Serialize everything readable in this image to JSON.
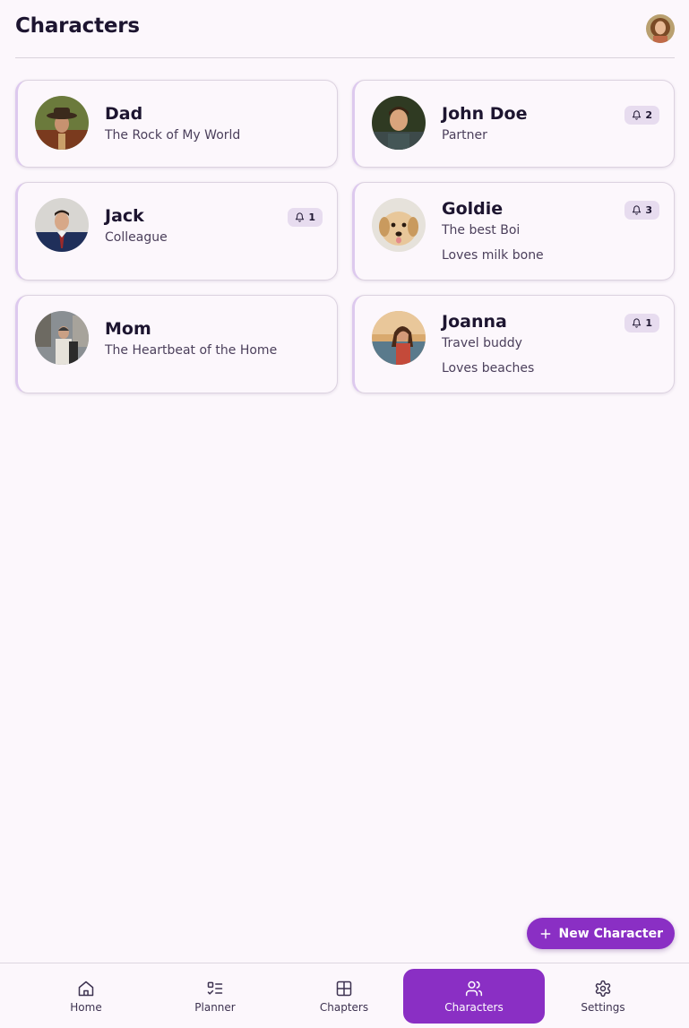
{
  "header": {
    "title": "Characters"
  },
  "characters": [
    {
      "name": "Dad",
      "role": "The Rock of My World",
      "extra": "",
      "notifications": ""
    },
    {
      "name": "John Doe",
      "role": "Partner",
      "extra": "",
      "notifications": "2"
    },
    {
      "name": "Jack",
      "role": "Colleague",
      "extra": "",
      "notifications": "1"
    },
    {
      "name": "Goldie",
      "role": "The best Boi",
      "extra": "Loves milk bone",
      "notifications": "3"
    },
    {
      "name": "Mom",
      "role": "The Heartbeat of the Home",
      "extra": "",
      "notifications": ""
    },
    {
      "name": "Joanna",
      "role": "Travel buddy",
      "extra": "Loves beaches",
      "notifications": "1"
    }
  ],
  "fab": {
    "label": "New Character"
  },
  "nav": {
    "home": "Home",
    "planner": "Planner",
    "chapters": "Chapters",
    "characters": "Characters",
    "settings": "Settings"
  },
  "icons": {
    "bell": "bell-icon",
    "plus": "plus-icon",
    "home": "home-icon",
    "planner": "planner-icon",
    "chapters": "grid-icon",
    "characters": "users-icon",
    "settings": "gear-icon"
  },
  "colors": {
    "accent": "#8a2fc4",
    "background": "#fcf7fc",
    "badge": "#e7dcef"
  }
}
